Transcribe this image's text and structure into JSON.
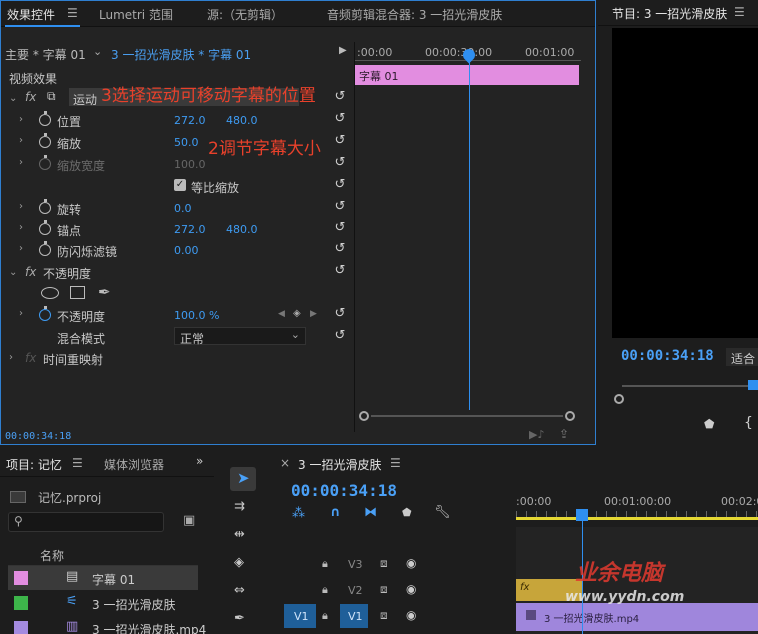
{
  "effect_controls": {
    "tabs": [
      "效果控件",
      "Lumetri 范围",
      "源:（无剪辑）",
      "音频剪辑混合器: 3 一招光滑皮肤"
    ],
    "master_label": "主要 * 字幕 01",
    "sequence_label": "3 一招光滑皮肤 * 字幕 01",
    "ruler": [
      ":00:00",
      "00:00:30:00",
      "00:01:00"
    ],
    "clip_name": "字幕 01",
    "section_video": "视频效果",
    "motion": {
      "label": "运动",
      "position": {
        "label": "位置",
        "x": "272.0",
        "y": "480.0"
      },
      "scale": {
        "label": "缩放",
        "value": "50.0"
      },
      "scale_width": {
        "label": "缩放宽度",
        "value": "100.0"
      },
      "uniform_scale": "等比缩放",
      "rotation": {
        "label": "旋转",
        "value": "0.0"
      },
      "anchor": {
        "label": "锚点",
        "x": "272.0",
        "y": "480.0"
      },
      "antiflicker": {
        "label": "防闪烁滤镜",
        "value": "0.00"
      }
    },
    "opacity": {
      "label": "不透明度",
      "opacity_label": "不透明度",
      "opacity_value": "100.0 %",
      "blend_label": "混合模式",
      "blend_value": "正常"
    },
    "time_remap": "时间重映射",
    "timecode": "00:00:34:18",
    "annotation1": "3选择运动可移动字幕的位置",
    "annotation2": "2调节字幕大小"
  },
  "program": {
    "title": "节目: 3 一招光滑皮肤",
    "timecode": "00:00:34:18",
    "fit": "适合"
  },
  "project": {
    "tabs": [
      "项目: 记忆",
      "媒体浏览器"
    ],
    "file": "记忆.prproj",
    "column_name": "名称",
    "items": [
      {
        "name": "字幕 01",
        "color": "#e28de0"
      },
      {
        "name": "3 一招光滑皮肤",
        "color": "#3db54a"
      },
      {
        "name": "3 一招光滑皮肤.mp4",
        "color": "#a48be0"
      }
    ]
  },
  "timeline": {
    "title": "3 一招光滑皮肤",
    "timecode": "00:00:34:18",
    "ruler": [
      ":00:00",
      "00:01:00:00",
      "00:02:0"
    ],
    "tracks": [
      "V3",
      "V2",
      "V1"
    ],
    "source_patch": "V1",
    "clip_label": "3 一招光滑皮肤.mp4",
    "clip_fx": "fx"
  },
  "watermark": {
    "text": "业余电脑",
    "url": "www.yydn.com"
  },
  "colors": {
    "accent_blue": "#2f8ff0",
    "clip_pink": "#e28de0",
    "clip_purple": "#9f86dc",
    "annotation_red": "#e8412b"
  }
}
